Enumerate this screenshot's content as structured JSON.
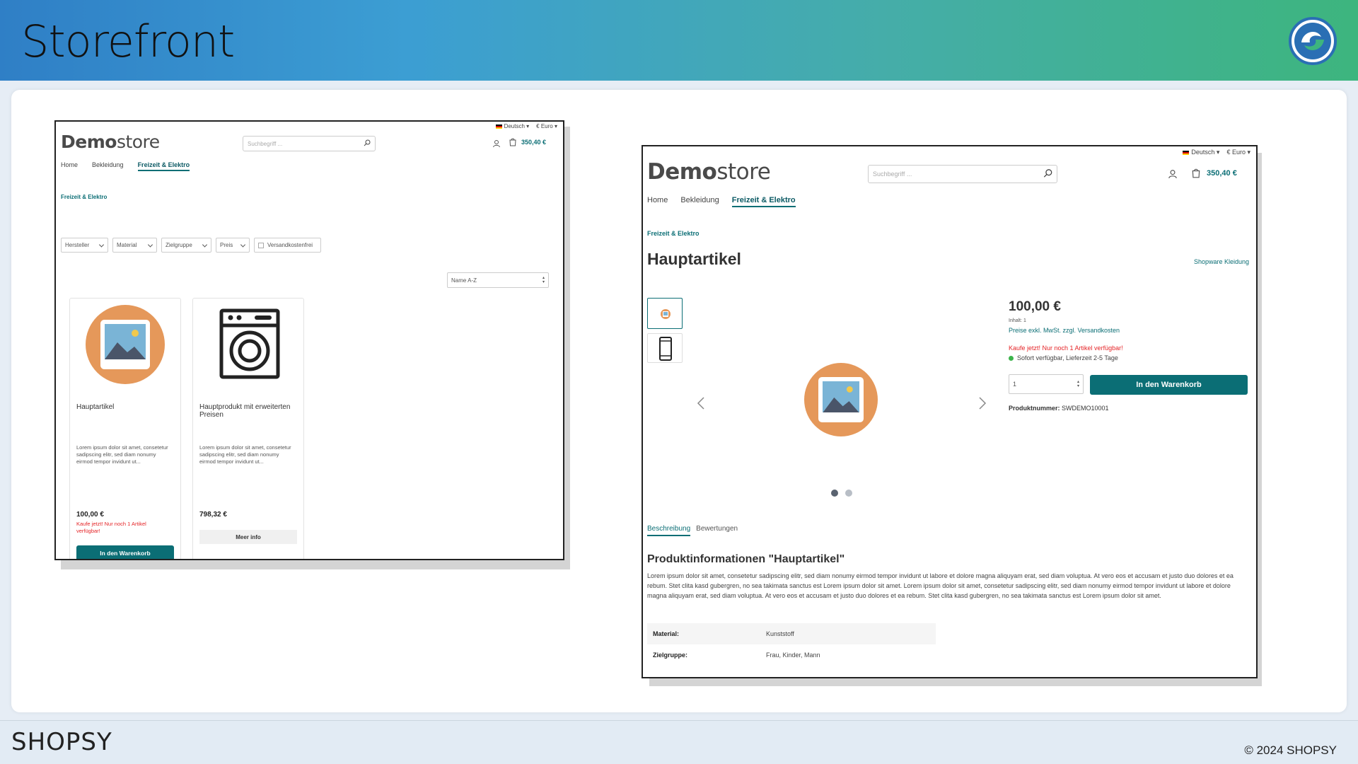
{
  "slide": {
    "title": "Storefront",
    "footer_logo": "SHOPSY",
    "copyright": "© 2024 SHOPSY"
  },
  "listing": {
    "language": "Deutsch",
    "currency": "€ Euro",
    "brand_bold": "Demo",
    "brand_light": "store",
    "search_placeholder": "Suchbegriff ...",
    "cart_total": "350,40 €",
    "nav": [
      "Home",
      "Bekleidung",
      "Freizeit & Elektro"
    ],
    "breadcrumb": "Freizeit & Elektro",
    "filters": [
      "Hersteller",
      "Material",
      "Zielgruppe",
      "Preis"
    ],
    "free_shipping": "Versandkostenfrei",
    "sort": "Name A-Z",
    "products": [
      {
        "name": "Hauptartikel",
        "desc": "Lorem ipsum dolor sit amet, consetetur sadipscing elitr, sed diam nonumy eirmod tempor invidunt ut...",
        "price": "100,00 €",
        "warning": "Kaufe jetzt! Nur noch 1 Artikel verfügbar!",
        "button": "In den Warenkorb"
      },
      {
        "name": "Hauptprodukt mit erweiterten Preisen",
        "desc": "Lorem ipsum dolor sit amet, consetetur sadipscing elitr, sed diam nonumy eirmod tempor invidunt ut...",
        "price": "798,32 €",
        "button": "Meer info"
      }
    ]
  },
  "detail": {
    "language": "Deutsch",
    "currency": "€ Euro",
    "brand_bold": "Demo",
    "brand_light": "store",
    "search_placeholder": "Suchbegriff ...",
    "cart_total": "350,40 €",
    "nav": [
      "Home",
      "Bekleidung",
      "Freizeit & Elektro"
    ],
    "breadcrumb": "Freizeit & Elektro",
    "title": "Hauptartikel",
    "manufacturer": "Shopware Kleidung",
    "price": "100,00 €",
    "content": "Inhalt: 1",
    "tax_note": "Preise exkl. MwSt. zzgl. Versandkosten",
    "warning": "Kaufe jetzt! Nur noch 1 Artikel verfügbar!",
    "delivery": "Sofort verfügbar, Lieferzeit 2-5 Tage",
    "quantity": "1",
    "cart_button": "In den Warenkorb",
    "product_number_label": "Produktnummer:",
    "product_number": "SWDEMO10001",
    "tabs": [
      "Beschreibung",
      "Bewertungen"
    ],
    "info_heading": "Produktinformationen \"Hauptartikel\"",
    "description": "Lorem ipsum dolor sit amet, consetetur sadipscing elitr, sed diam nonumy eirmod tempor invidunt ut labore et dolore magna aliquyam erat, sed diam voluptua. At vero eos et accusam et justo duo dolores et ea rebum. Stet clita kasd gubergren, no sea takimata sanctus est Lorem ipsum dolor sit amet. Lorem ipsum dolor sit amet, consetetur sadipscing elitr, sed diam nonumy eirmod tempor invidunt ut labore et dolore magna aliquyam erat, sed diam voluptua. At vero eos et accusam et justo duo dolores et ea rebum. Stet clita kasd gubergren, no sea takimata sanctus est Lorem ipsum dolor sit amet.",
    "properties": [
      {
        "key": "Material:",
        "value": "Kunststoff"
      },
      {
        "key": "Zielgruppe:",
        "value": "Frau, Kinder, Mann"
      }
    ]
  },
  "colors": {
    "accent": "#0b6e75",
    "warning": "#e52427",
    "available": "#3cb44b",
    "image_bg": "#e5985a"
  }
}
